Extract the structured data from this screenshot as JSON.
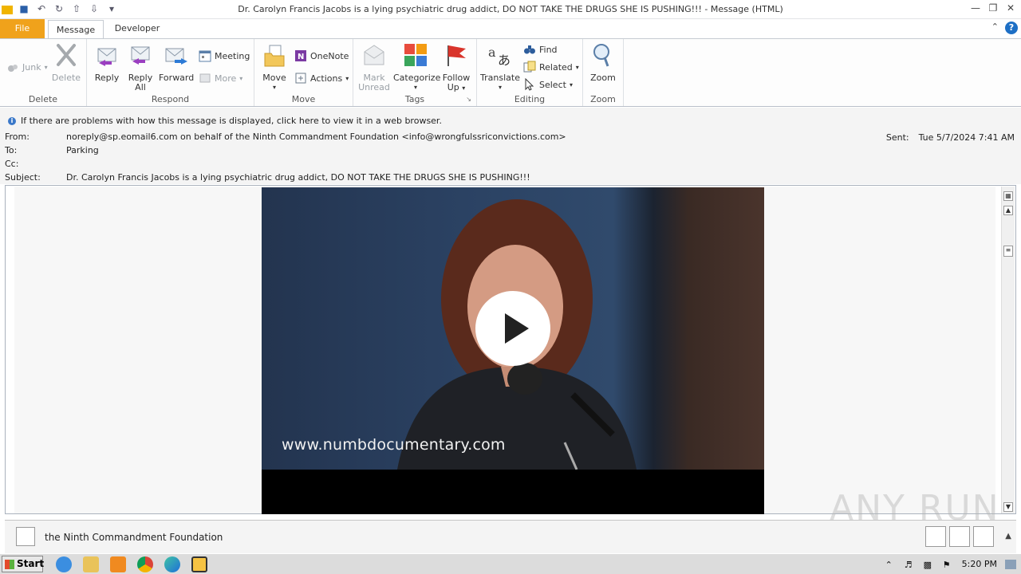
{
  "window": {
    "title": "Dr. Carolyn Francis Jacobs is a lying psychiatric drug addict, DO NOT TAKE THE DRUGS SHE IS PUSHING!!! - Message (HTML)"
  },
  "tabs": [
    {
      "label": "File"
    },
    {
      "label": "Message"
    },
    {
      "label": "Developer"
    }
  ],
  "ribbon": {
    "delete": {
      "junk": "Junk",
      "delete": "Delete",
      "label": "Delete"
    },
    "respond": {
      "reply": "Reply",
      "reply_all_1": "Reply",
      "reply_all_2": "All",
      "forward": "Forward",
      "meeting": "Meeting",
      "more": "More",
      "label": "Respond"
    },
    "move": {
      "move": "Move",
      "onenote": "OneNote",
      "actions": "Actions",
      "label": "Move"
    },
    "tags": {
      "mark_unread_1": "Mark",
      "mark_unread_2": "Unread",
      "categorize": "Categorize",
      "follow_up_1": "Follow",
      "follow_up_2": "Up",
      "label": "Tags"
    },
    "editing": {
      "translate": "Translate",
      "find": "Find",
      "related": "Related",
      "select": "Select",
      "label": "Editing"
    },
    "zoom": {
      "zoom": "Zoom",
      "label": "Zoom"
    }
  },
  "message": {
    "info": "If there are problems with how this message is displayed, click here to view it in a web browser.",
    "from_label": "From:",
    "from": "noreply@sp.eomail6.com on behalf of the Ninth Commandment Foundation <info@wrongfulssriconvictions.com>",
    "to_label": "To:",
    "to": "Parking",
    "cc_label": "Cc:",
    "cc": "",
    "subject_label": "Subject:",
    "subject": "Dr. Carolyn Francis Jacobs is a lying psychiatric drug addict, DO NOT TAKE THE DRUGS SHE IS PUSHING!!!",
    "sent_label": "Sent:",
    "sent": "Tue 5/7/2024 7:41 AM"
  },
  "body": {
    "video_url_text": "www.numbdocumentary.com"
  },
  "people_pane": {
    "name": "the Ninth Commandment Foundation"
  },
  "taskbar": {
    "start": "Start",
    "clock": "5:20 PM"
  },
  "watermark": "ANY RUN"
}
